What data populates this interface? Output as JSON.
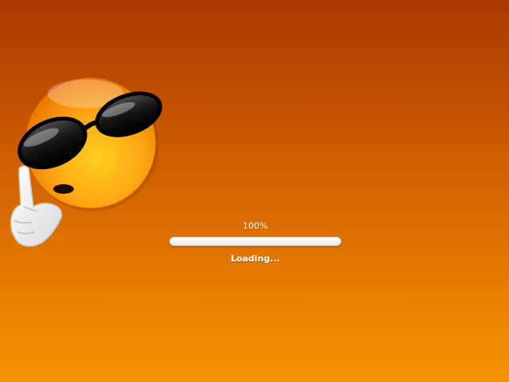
{
  "loader": {
    "percent_label": "100%",
    "progress_fraction": 1.0,
    "status_label": "Loading..."
  },
  "mascot": {
    "icon": "cool-smiley-sunglasses-icon"
  },
  "colors": {
    "background_top": "#a93800",
    "background_bottom": "#f79400",
    "text": "#ffffff",
    "bar_fill": "#ffffff"
  }
}
